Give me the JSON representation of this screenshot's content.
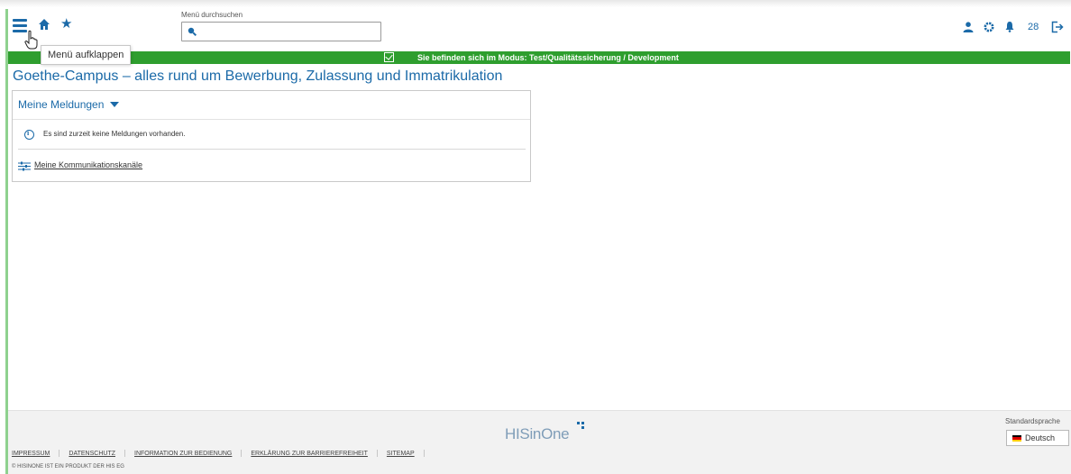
{
  "header": {
    "search_label": "Menü durchsuchen",
    "search_placeholder": "",
    "tooltip": "Menü aufklappen",
    "notification_count": "28"
  },
  "icons": {
    "menu": "menu-icon",
    "home": "home-icon",
    "favorites": "star-icon",
    "search": "search-icon",
    "user": "user-icon",
    "settings": "gear-icon",
    "notifications": "bell-icon",
    "logout": "logout-icon"
  },
  "mode_bar": {
    "text": "Sie befinden sich im Modus: Test/Qualitätssicherung / Development",
    "color": "#2e9e2e"
  },
  "page": {
    "title": "Goethe-Campus – alles rund um Bewerbung, Zulassung und Immatrikulation"
  },
  "panel": {
    "title": "Meine Meldungen",
    "message": "Es sind zurzeit keine Meldungen vorhanden.",
    "link": "Meine Kommunikationskanäle"
  },
  "footer": {
    "brand": "HISinOne",
    "links": [
      "IMPRESSUM",
      "DATENSCHUTZ",
      "INFORMATION ZUR BEDIENUNG",
      "ERKLÄRUNG ZUR BARRIEREFREIHEIT",
      "SITEMAP"
    ],
    "copyright": "© HISINONE IST EIN PRODUKT DER HIS EG",
    "language_label": "Standardsprache",
    "language_value": "Deutsch"
  },
  "colors": {
    "accent": "#1b6aa8",
    "mode_green": "#2e9e2e"
  }
}
